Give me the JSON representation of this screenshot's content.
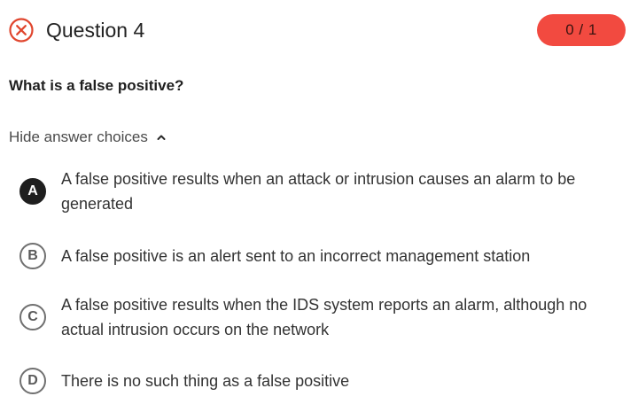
{
  "question": {
    "title": "Question 4",
    "status_icon": "incorrect-x-circle-icon",
    "score": "0 / 1",
    "text": "What is a false positive?"
  },
  "choices_toggle": {
    "label": "Hide answer choices",
    "icon": "chevron-up-icon"
  },
  "choices": [
    {
      "letter": "A",
      "text": "A false positive results when an attack or intrusion causes an alarm to be generated",
      "selected": true
    },
    {
      "letter": "B",
      "text": "A false positive is an alert sent to an incorrect management station",
      "selected": false
    },
    {
      "letter": "C",
      "text": "A false positive results when the IDS system reports an alarm, although no actual intrusion occurs on the network",
      "selected": false
    },
    {
      "letter": "D",
      "text": "There is no such thing as a false positive",
      "selected": false
    }
  ],
  "colors": {
    "incorrect": "#e0452d",
    "score_badge": "#f24a40",
    "selected_choice": "#1f1f1f"
  }
}
